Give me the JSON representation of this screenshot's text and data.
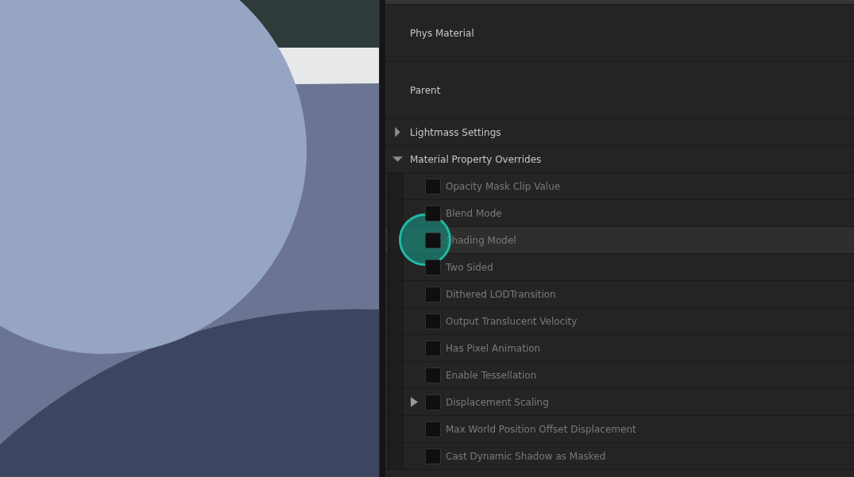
{
  "details": {
    "properties": [
      {
        "label": "Phys Material"
      },
      {
        "label": "Parent"
      }
    ],
    "categories": [
      {
        "label": "Lightmass Settings",
        "expanded": false
      },
      {
        "label": "Material Property Overrides",
        "expanded": true,
        "overrides": [
          {
            "label": "Opacity Mask Clip Value",
            "checked": false,
            "selected": false,
            "expandable": false
          },
          {
            "label": "Blend Mode",
            "checked": false,
            "selected": false,
            "expandable": false
          },
          {
            "label": "Shading Model",
            "checked": false,
            "selected": true,
            "expandable": false
          },
          {
            "label": "Two Sided",
            "checked": false,
            "selected": false,
            "expandable": false
          },
          {
            "label": "Dithered LODTransition",
            "checked": false,
            "selected": false,
            "expandable": false
          },
          {
            "label": "Output Translucent Velocity",
            "checked": false,
            "selected": false,
            "expandable": false
          },
          {
            "label": "Has Pixel Animation",
            "checked": false,
            "selected": false,
            "expandable": false
          },
          {
            "label": "Enable Tessellation",
            "checked": false,
            "selected": false,
            "expandable": false
          },
          {
            "label": "Displacement Scaling",
            "checked": false,
            "selected": false,
            "expandable": true
          },
          {
            "label": "Max World Position Offset Displacement",
            "checked": false,
            "selected": false,
            "expandable": false
          },
          {
            "label": "Cast Dynamic Shadow as Masked",
            "checked": false,
            "selected": false,
            "expandable": false
          }
        ]
      }
    ]
  }
}
